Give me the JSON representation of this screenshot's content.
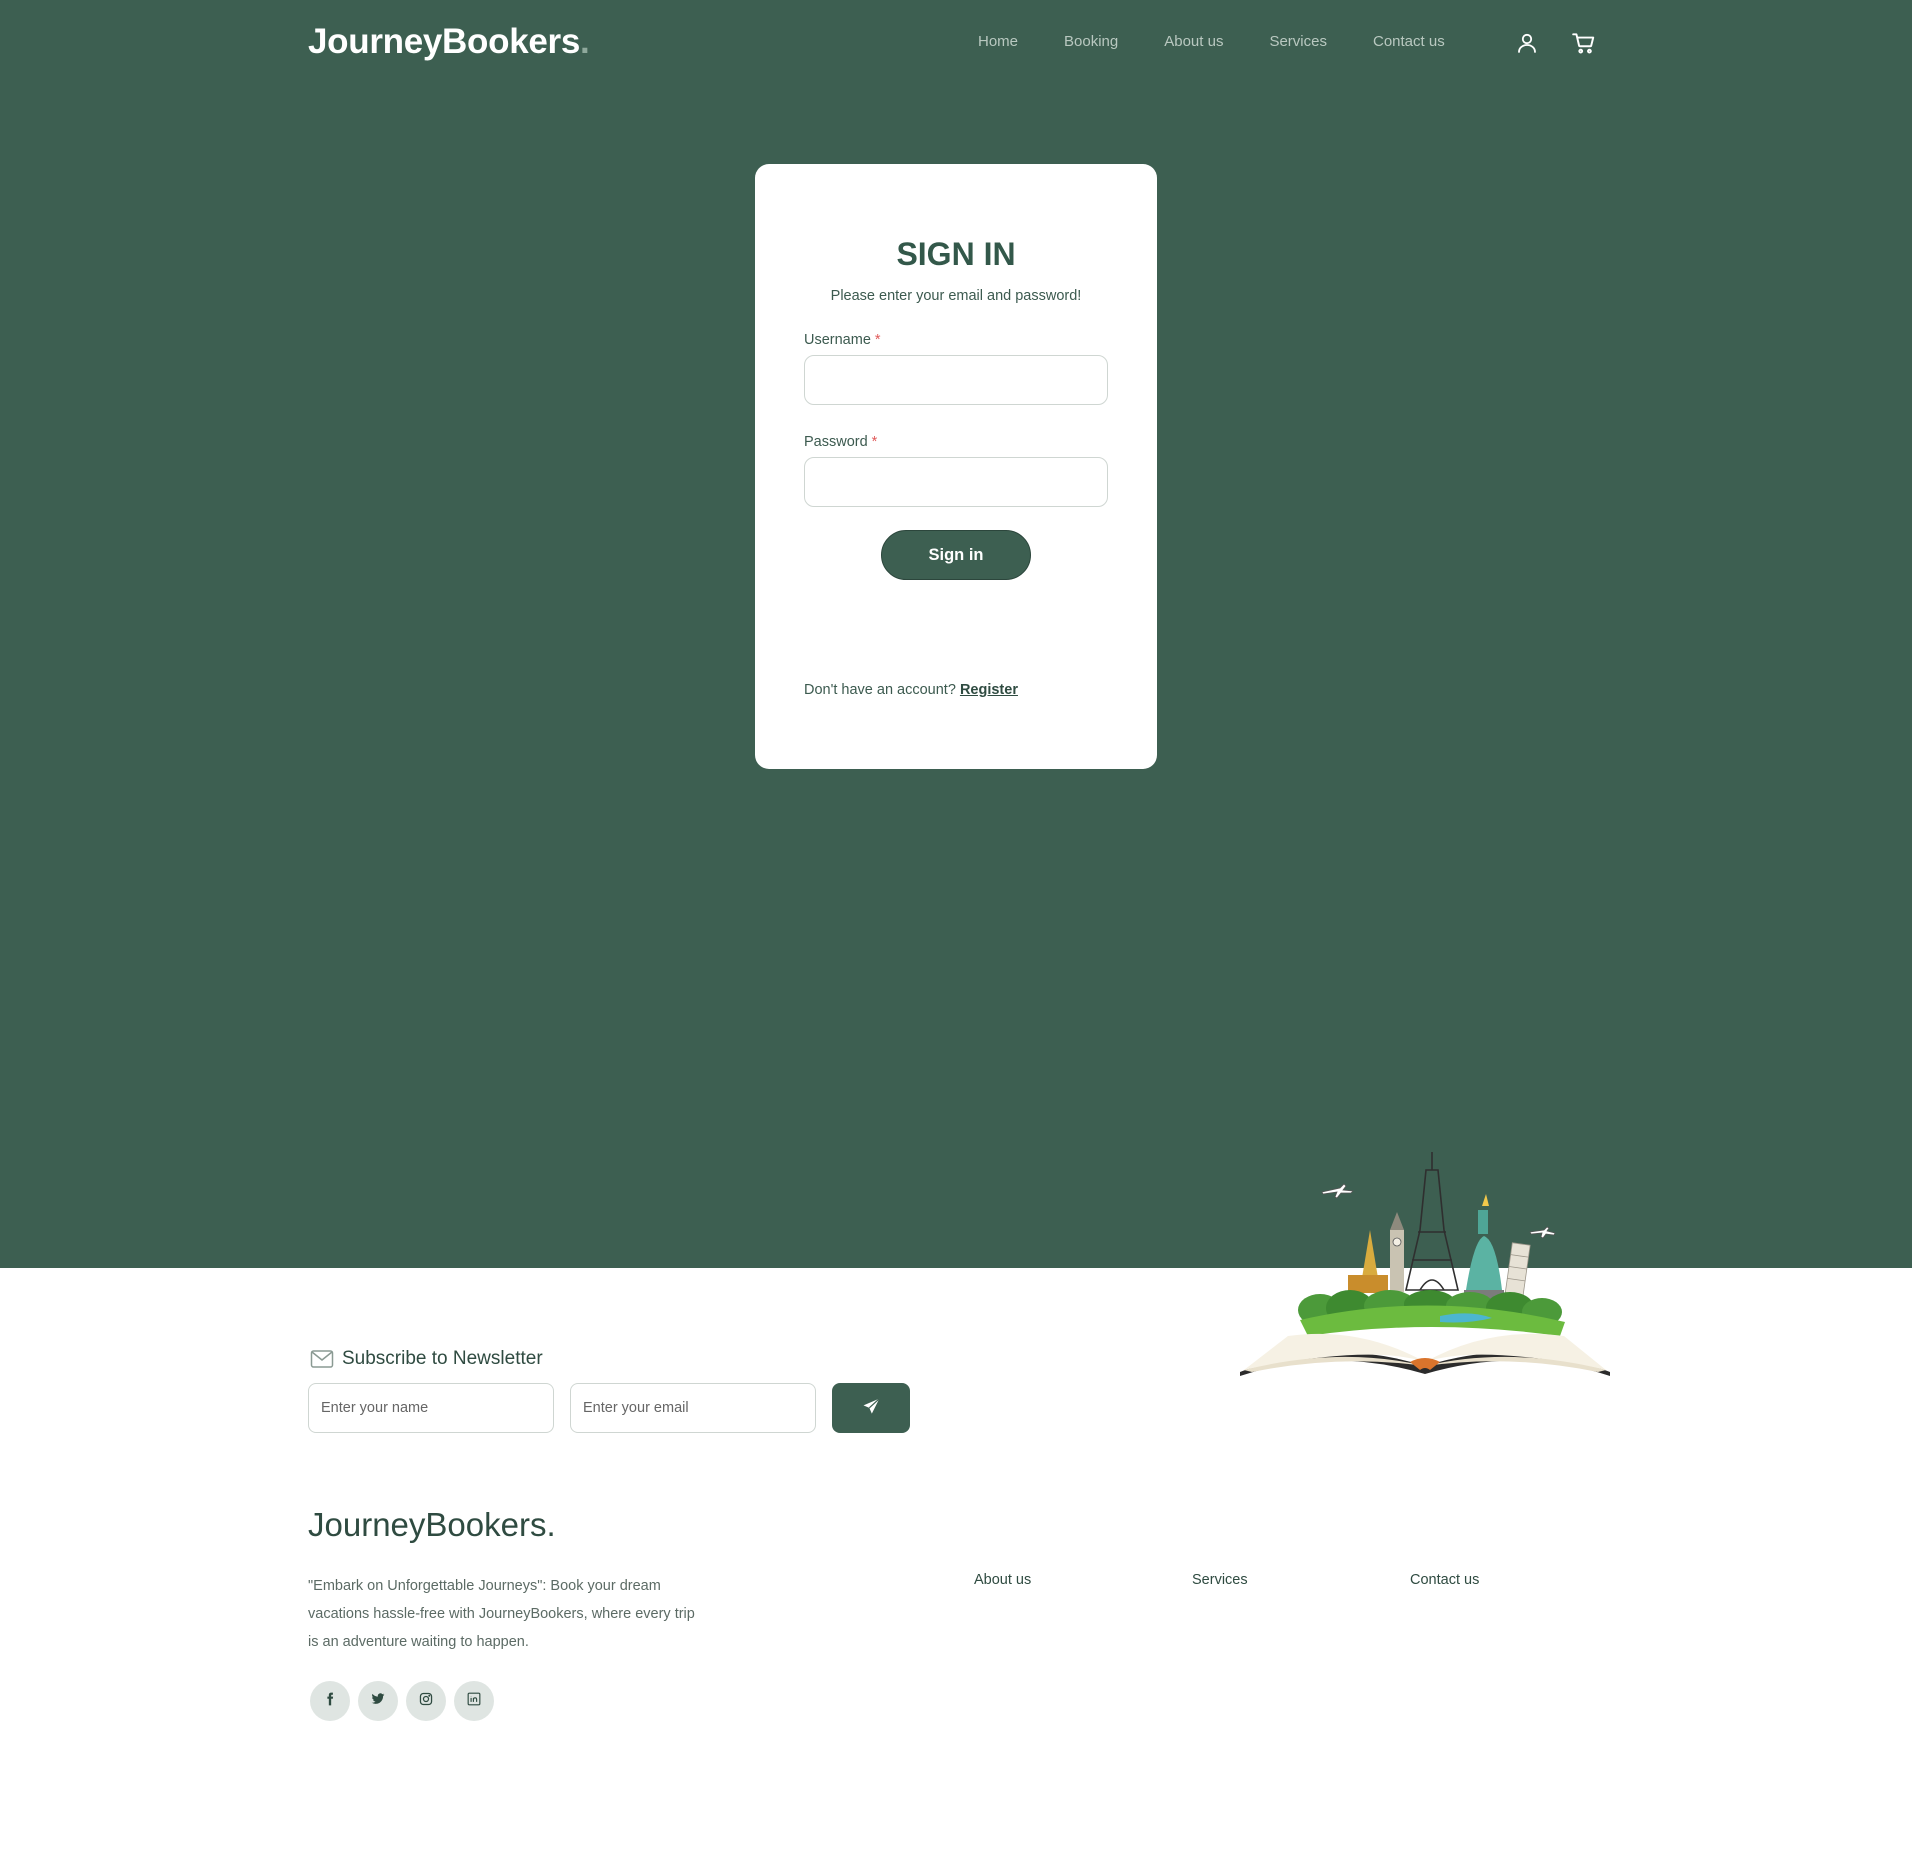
{
  "header": {
    "logo": "JourneyBookers",
    "logo_dot": ".",
    "nav": [
      "Home",
      "Booking",
      "About us",
      "Services",
      "Contact us"
    ]
  },
  "signin": {
    "title": "SIGN IN",
    "subtitle": "Please enter your email and password!",
    "username_label": "Username",
    "password_label": "Password",
    "required_mark": "*",
    "button": "Sign in",
    "no_account": "Don't have an account?",
    "register": "Register"
  },
  "newsletter": {
    "title": "Subscribe to Newsletter",
    "name_placeholder": "Enter your name",
    "email_placeholder": "Enter your email"
  },
  "footer": {
    "logo": "JourneyBookers.",
    "description": "\"Embark on Unforgettable Journeys\": Book your dream vacations hassle-free with JourneyBookers, where every trip is an adventure waiting to happen.",
    "links": [
      "About us",
      "Services",
      "Contact us"
    ]
  },
  "colors": {
    "primary": "#3d5f51",
    "background": "#ffffff",
    "required": "#e05a5a"
  },
  "icons": {
    "header": [
      "user-icon",
      "cart-icon"
    ],
    "newsletter": [
      "mail-icon",
      "send-icon"
    ],
    "social": [
      "facebook-icon",
      "twitter-icon",
      "instagram-icon",
      "linkedin-icon"
    ]
  }
}
